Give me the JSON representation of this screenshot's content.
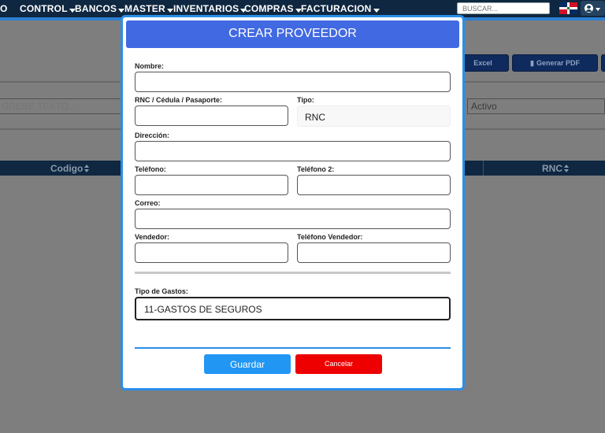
{
  "nav": {
    "items": [
      "O",
      "CONTROL",
      "BANCOS",
      "MASTER",
      "INVENTARIOS",
      "COMPRAS",
      "FACTURACION"
    ],
    "search_placeholder": "BUSCAR..."
  },
  "background": {
    "excel_label": "Excel",
    "pdf_label": "Generar PDF",
    "search_placeholder": "GRESE TEXTO...",
    "status_value": "Activo",
    "table_headers": [
      "Codigo",
      "RNC"
    ]
  },
  "modal": {
    "title": "CREAR PROVEEDOR",
    "fields": {
      "nombre": "Nombre:",
      "rnc": "RNC / Cédula / Pasaporte:",
      "tipo": "Tipo:",
      "direccion": "Dirección:",
      "telefono": "Teléfono:",
      "telefono2": "Teléfono 2:",
      "correo": "Correo:",
      "vendedor": "Vendedor:",
      "telefono_vendedor": "Teléfono Vendedor:",
      "tipo_gastos": "Tipo de Gastos:"
    },
    "tipo_value": "RNC",
    "tipo_gastos_value": "11-GASTOS DE SEGUROS",
    "save_label": "Guardar",
    "cancel_label": "Cancelar"
  },
  "colors": {
    "nav_bg": "#0f2740",
    "modal_header": "#4169e1",
    "modal_border": "#2a8ee8",
    "save_button": "#2196f3",
    "cancel_button": "#ee0000"
  },
  "icons": [
    "caret-down-icon",
    "flag-icon",
    "user-icon",
    "sort-icon",
    "pdf-icon"
  ]
}
